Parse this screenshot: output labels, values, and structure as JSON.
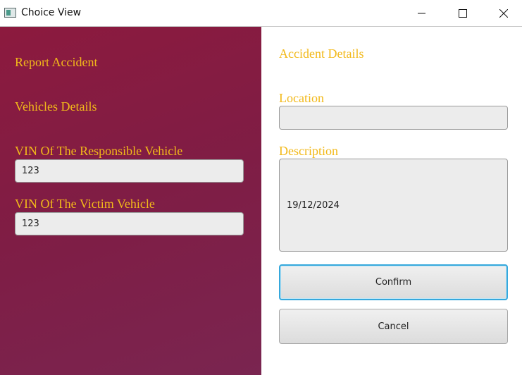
{
  "window": {
    "title": "Choice View"
  },
  "left": {
    "report_accident": "Report Accident",
    "vehicles_details": "Vehicles Details",
    "responsible_vin_label": "VIN Of The Responsible Vehicle",
    "responsible_vin_value": "123",
    "victim_vin_label": "VIN Of The Victim Vehicle",
    "victim_vin_value": "123"
  },
  "right": {
    "accident_details": "Accident Details",
    "location_label": "Location",
    "location_value": "",
    "description_label": "Description",
    "description_value": "19/12/2024",
    "confirm_label": "Confirm",
    "cancel_label": "Cancel"
  },
  "colors": {
    "accent_text": "#f2b91a",
    "left_panel": "#8c1a3e",
    "focus_border": "#36a8dc"
  }
}
